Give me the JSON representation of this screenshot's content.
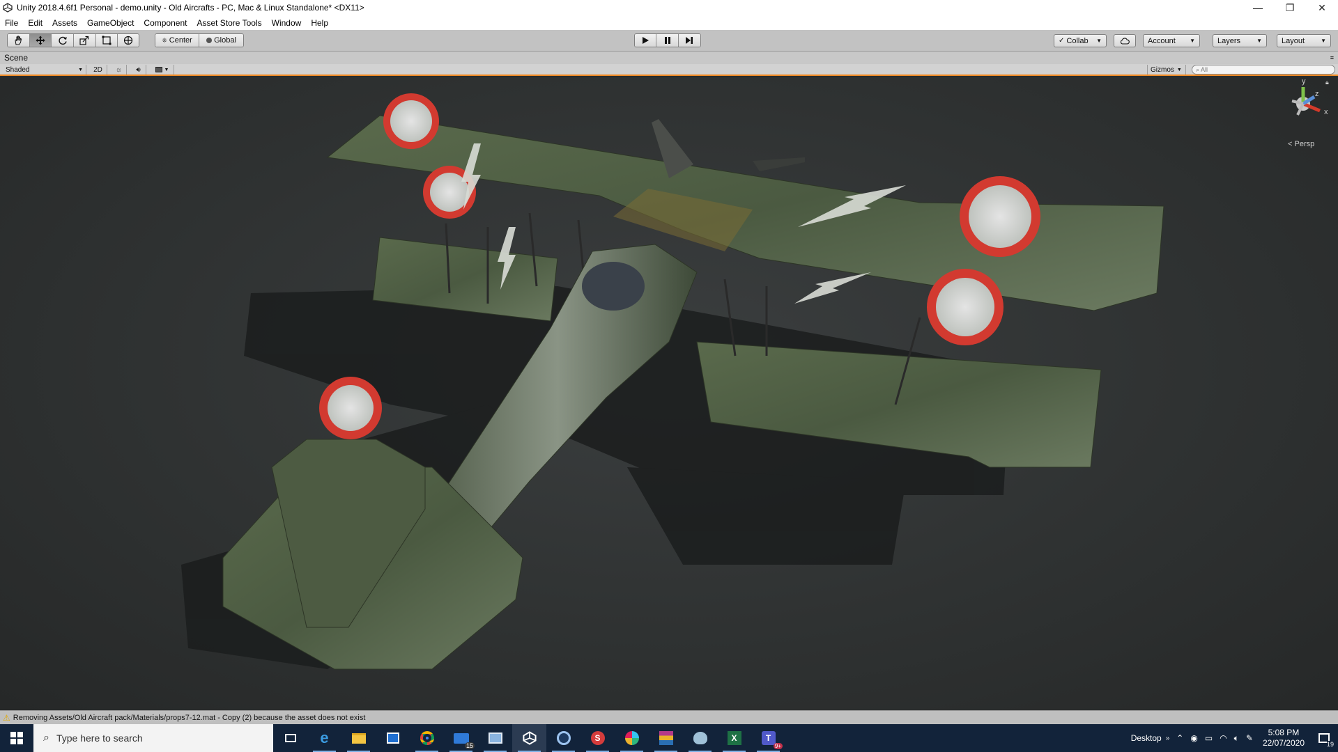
{
  "window": {
    "title": "Unity 2018.4.6f1 Personal - demo.unity - Old Aircrafts - PC, Mac & Linux Standalone* <DX11>",
    "minimize": "—",
    "maximize": "❐",
    "close": "✕"
  },
  "menu": [
    "File",
    "Edit",
    "Assets",
    "GameObject",
    "Component",
    "Asset Store Tools",
    "Window",
    "Help"
  ],
  "toolbar": {
    "pivot_mode": "Center",
    "pivot_rotation": "Global",
    "collab": "Collab",
    "account": "Account",
    "layers": "Layers",
    "layout": "Layout"
  },
  "scene": {
    "tab_label": "Scene",
    "shading_mode": "Shaded",
    "mode_2d": "2D",
    "gizmos": "Gizmos",
    "search_placeholder": "All",
    "projection": "Persp",
    "axis_y": "y",
    "axis_z": "z",
    "axis_x": "x"
  },
  "status": {
    "message": "Removing Assets/Old Aircraft pack/Materials/props7-12.mat - Copy (2) because the asset does not exist"
  },
  "taskbar": {
    "search_placeholder": "Type here to search",
    "desktop_label": "Desktop",
    "time": "5:08 PM",
    "date": "22/07/2020",
    "notification_count": "19",
    "apps": [
      {
        "name": "task-view",
        "badge": ""
      },
      {
        "name": "edge",
        "badge": ""
      },
      {
        "name": "file-explorer",
        "badge": ""
      },
      {
        "name": "store",
        "badge": ""
      },
      {
        "name": "chrome",
        "badge": ""
      },
      {
        "name": "mail",
        "badge": "15"
      },
      {
        "name": "remote-desktop",
        "badge": ""
      },
      {
        "name": "unity",
        "badge": ""
      },
      {
        "name": "app-circle",
        "badge": ""
      },
      {
        "name": "app-s",
        "badge": ""
      },
      {
        "name": "slack",
        "badge": ""
      },
      {
        "name": "winrar",
        "badge": ""
      },
      {
        "name": "app-bird",
        "badge": ""
      },
      {
        "name": "excel",
        "badge": ""
      },
      {
        "name": "teams",
        "badge": "9+"
      }
    ]
  },
  "colors": {
    "accent_orange": "#f08a24",
    "aircraft_green": "#4a5a40",
    "roundel_red": "#d23a30"
  }
}
